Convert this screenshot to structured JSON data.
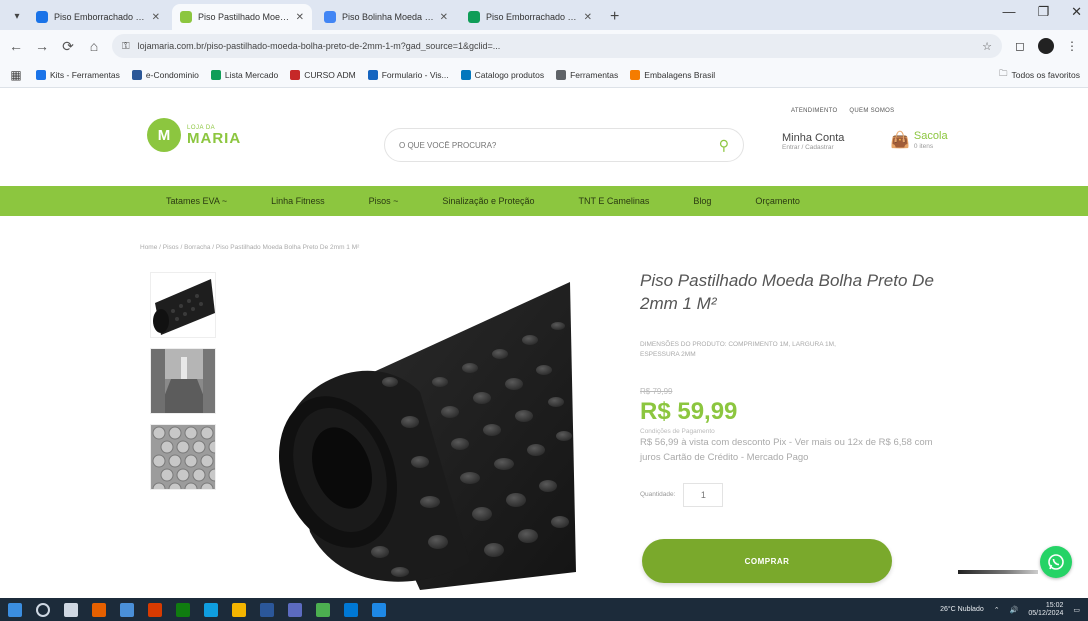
{
  "browser": {
    "tabs": [
      {
        "title": "Piso Emborrachado Moeda...",
        "favicon_color": "#1a73e8",
        "active": false
      },
      {
        "title": "Piso Pastilhado Moeda Bolha Pr...",
        "favicon_color": "#8cc63f",
        "active": true
      },
      {
        "title": "Piso Bolinha Moeda Preto...",
        "favicon_color": "#4285f4",
        "active": false
      },
      {
        "title": "Piso Emborrachado Pastilhado...",
        "favicon_color": "#0f9d58",
        "active": false
      }
    ],
    "new_tab_label": "+",
    "url": "lojamaria.com.br/piso-pastilhado-moeda-bolha-preto-de-2mm-1-m?gad_source=1&gclid=...",
    "bookmarks": [
      {
        "label": "Kits - Ferramentas",
        "color": "#1a73e8"
      },
      {
        "label": "e-Condominio",
        "color": "#2b5797"
      },
      {
        "label": "Lista Mercado",
        "color": "#0f9d58"
      },
      {
        "label": "CURSO ADM",
        "color": "#c62828"
      },
      {
        "label": "Formulario - Vis...",
        "color": "#1565c0"
      },
      {
        "label": "Catalogo produtos",
        "color": "#0277bd"
      },
      {
        "label": "Ferramentas",
        "color": "#5f6368"
      },
      {
        "label": "Embalagens Brasil",
        "color": "#f57c00"
      }
    ],
    "bookmarks_right": "Todos os favoritos"
  },
  "site": {
    "logo_small": "LOJA DA",
    "logo_big": "MARIA",
    "search_placeholder": "O QUE VOCÊ PROCURA?",
    "top_links": [
      "ATENDIMENTO",
      "QUEM SOMOS"
    ],
    "account_title": "Minha Conta",
    "account_sub": "Entrar / Cadastrar",
    "cart_title": "Sacola",
    "cart_sub": "0 itens",
    "nav": [
      "Tatames EVA ~",
      "Linha Fitness",
      "Pisos ~",
      "Sinalização e Proteção",
      "TNT E Camelinas",
      "Blog",
      "Orçamento"
    ],
    "breadcrumb": "Home / Pisos / Borracha / Piso Pastilhado Moeda Bolha Preto De 2mm 1 M²"
  },
  "product": {
    "title": "Piso Pastilhado Moeda Bolha Preto De 2mm 1 M²",
    "description": "DIMENSÕES DO PRODUTO: COMPRIMENTO 1M, LARGURA 1M, ESPESSURA 2MM",
    "old_price": "R$ 79,99",
    "price": "R$ 59,99",
    "installments_label": "Condições de Pagamento",
    "installments": "R$ 56,99 à vista com desconto Pix - Ver mais ou 12x de R$ 6,58 com juros Cartão de Crédito - Mercado Pago",
    "quantity_label": "Quantidade:",
    "quantity": "1",
    "buy_label": "COMPRAR"
  },
  "taskbar": {
    "weather": "26°C Nublado",
    "time": "15:02",
    "date": "05/12/2024"
  },
  "colors": {
    "brand_green": "#8cc63f",
    "button_green": "#7aa92c",
    "whatsapp": "#25d366"
  }
}
